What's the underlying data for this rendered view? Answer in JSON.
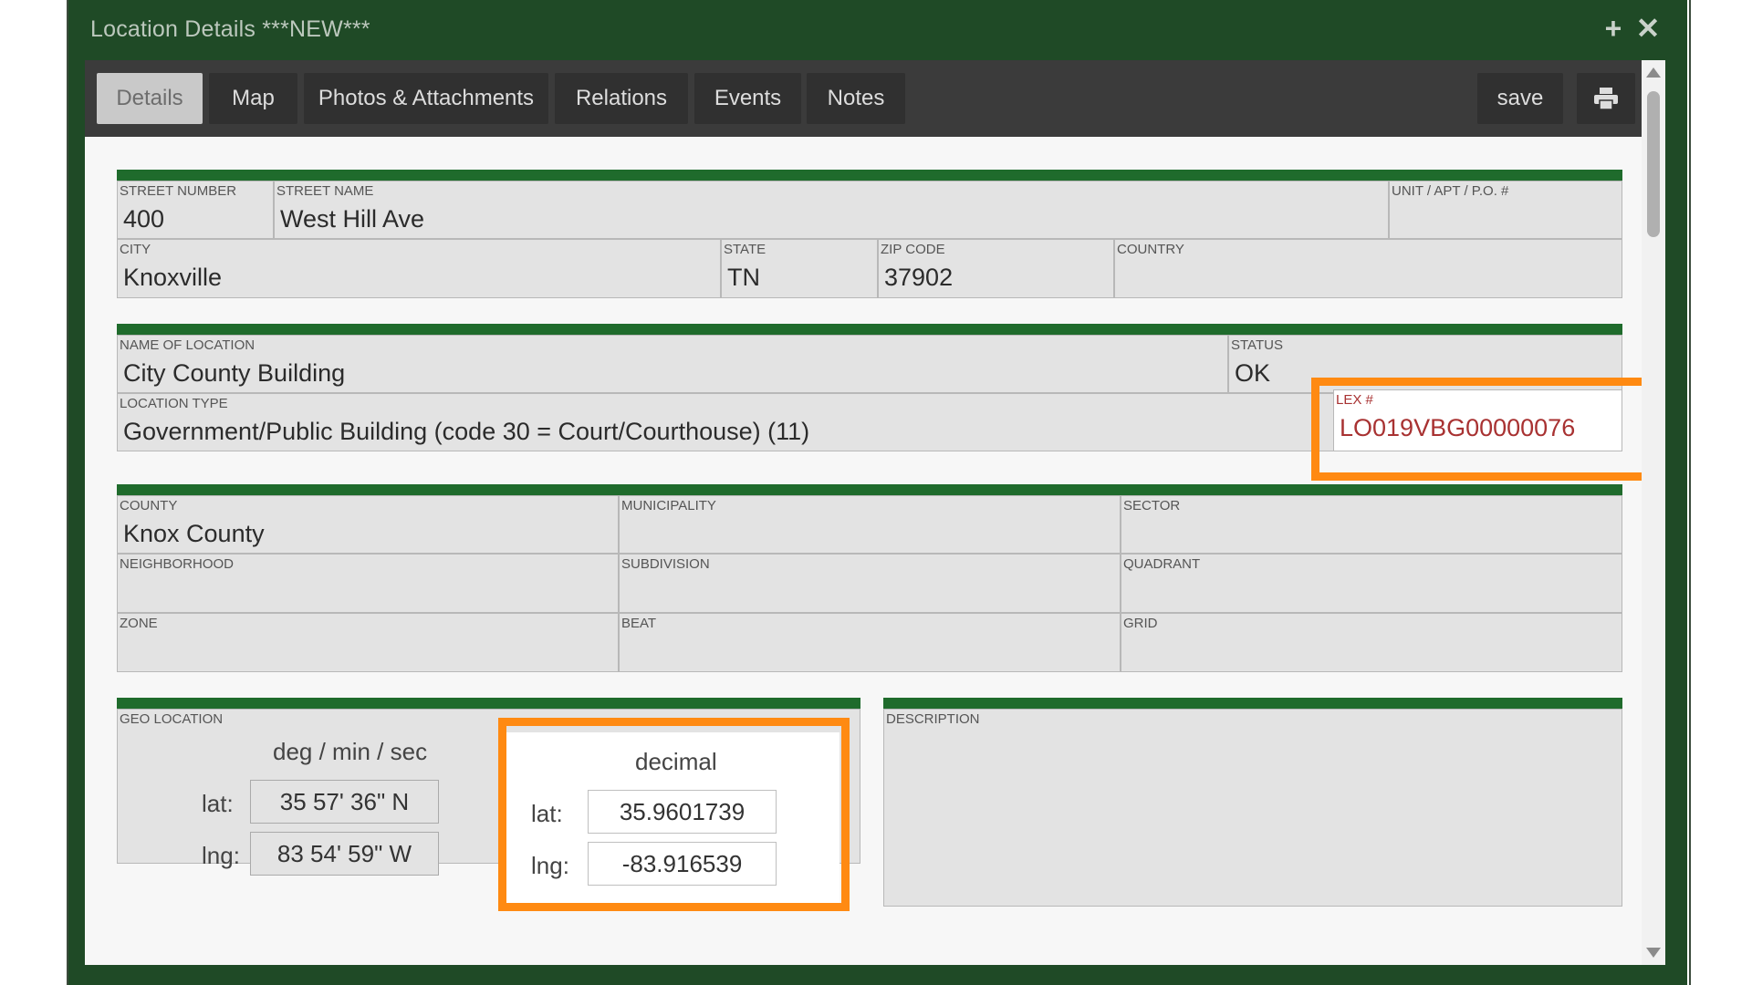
{
  "window": {
    "title": "Location Details ***NEW***",
    "icons": {
      "add": "plus-icon",
      "close": "close-icon"
    }
  },
  "tabs": [
    {
      "label": "Details",
      "active": true
    },
    {
      "label": "Map",
      "active": false
    },
    {
      "label": "Photos & Attachments",
      "active": false
    },
    {
      "label": "Relations",
      "active": false
    },
    {
      "label": "Events",
      "active": false
    },
    {
      "label": "Notes",
      "active": false
    }
  ],
  "toolbar": {
    "save_label": "save",
    "print_icon": "printer-icon"
  },
  "address": {
    "street_number": {
      "label": "STREET NUMBER",
      "value": "400"
    },
    "street_name": {
      "label": "STREET NAME",
      "value": "West Hill Ave"
    },
    "unit": {
      "label": "UNIT / APT / P.O. #",
      "value": ""
    },
    "city": {
      "label": "CITY",
      "value": "Knoxville"
    },
    "state": {
      "label": "STATE",
      "value": "TN"
    },
    "zip": {
      "label": "ZIP CODE",
      "value": "37902"
    },
    "country": {
      "label": "COUNTRY",
      "value": ""
    }
  },
  "location": {
    "name": {
      "label": "NAME OF LOCATION",
      "value": "City County Building"
    },
    "status": {
      "label": "STATUS",
      "value": "OK"
    },
    "type": {
      "label": "LOCATION TYPE",
      "value": "Government/Public Building (code 30 = Court/Courthouse) (11)"
    },
    "lex": {
      "label": "LEX #",
      "value": "LO019VBG00000076"
    }
  },
  "area": {
    "county": {
      "label": "COUNTY",
      "value": "Knox County"
    },
    "municipality": {
      "label": "MUNICIPALITY",
      "value": ""
    },
    "sector": {
      "label": "SECTOR",
      "value": ""
    },
    "neighborhood": {
      "label": "NEIGHBORHOOD",
      "value": ""
    },
    "subdivision": {
      "label": "SUBDIVISION",
      "value": ""
    },
    "quadrant": {
      "label": "QUADRANT",
      "value": ""
    },
    "zone": {
      "label": "ZONE",
      "value": ""
    },
    "beat": {
      "label": "BEAT",
      "value": ""
    },
    "grid": {
      "label": "GRID",
      "value": ""
    }
  },
  "geo": {
    "label": "GEO LOCATION",
    "dms_header": "deg / min / sec",
    "decimal_header": "decimal",
    "lat_label": "lat:",
    "lng_label": "lng:",
    "dms_lat": "35 57' 36\" N",
    "dms_lng": "83 54' 59\" W",
    "dec_lat": "35.9601739",
    "dec_lng": "-83.916539"
  },
  "description": {
    "label": "DESCRIPTION",
    "value": ""
  },
  "colors": {
    "frame_green": "#1f4a26",
    "section_bar_green": "#1f6b2c",
    "highlight_orange": "#ff8a12",
    "lex_red": "#a83232"
  }
}
